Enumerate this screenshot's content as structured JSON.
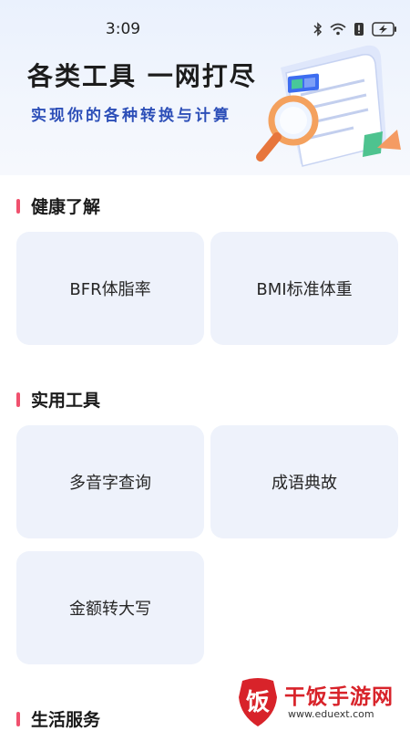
{
  "status_bar": {
    "time": "3:09",
    "icons": [
      "bluetooth-icon",
      "wifi-icon",
      "alert-icon",
      "battery-charging-icon"
    ]
  },
  "hero": {
    "title": "各类工具 一网打尽",
    "subtitle": "实现你的各种转换与计算"
  },
  "sections": [
    {
      "title": "健康了解",
      "items": [
        {
          "label": "BFR体脂率"
        },
        {
          "label": "BMI标准体重"
        }
      ]
    },
    {
      "title": "实用工具",
      "items": [
        {
          "label": "多音字查询"
        },
        {
          "label": "成语典故"
        },
        {
          "label": "金额转大写"
        }
      ]
    },
    {
      "title": "生活服务",
      "items": []
    }
  ],
  "watermark": {
    "logo_char": "饭",
    "name": "干饭手游网",
    "url": "www.eduext.com"
  },
  "colors": {
    "accent_bar": "#f0516e",
    "card_bg": "#eef2fb",
    "subtitle": "#2d4fb8",
    "watermark_red": "#d8232a"
  }
}
